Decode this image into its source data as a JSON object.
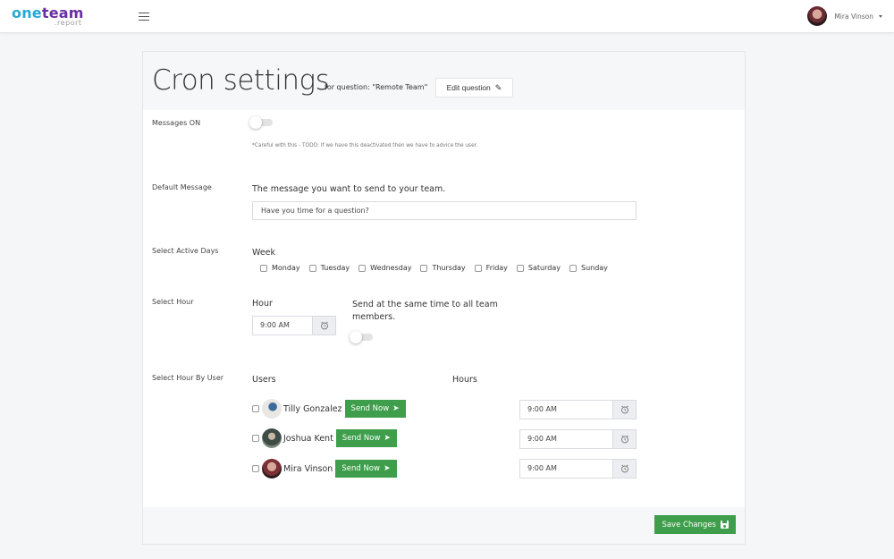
{
  "app": {
    "logo_primary_a": "one",
    "logo_primary_b": "team",
    "logo_secondary": ".report",
    "colors": {
      "logo_blue": "#27a9d6",
      "logo_purple": "#6b2fa3",
      "accent_green": "#3e9e4b"
    }
  },
  "header": {
    "menu_icon": "hamburger-icon",
    "user_name": "Mira Vinson",
    "user_menu_icon": "caret-down-icon"
  },
  "page": {
    "title": "Cron settings",
    "subtitle": "for question: \"Remote Team\"",
    "edit_button": "Edit question",
    "edit_icon": "pencil-icon"
  },
  "messages_on": {
    "label": "Messages ON",
    "enabled": false,
    "hint": "*Careful with this - TODO: If we have this deactivated then we have to advice the user."
  },
  "default_message": {
    "label": "Default Message",
    "description": "The message you want to send to your team.",
    "value": "Have you time for a question?"
  },
  "active_days": {
    "label": "Select Active Days",
    "group_label": "Week",
    "days": [
      {
        "name": "Monday",
        "checked": false
      },
      {
        "name": "Tuesday",
        "checked": false
      },
      {
        "name": "Wednesday",
        "checked": false
      },
      {
        "name": "Thursday",
        "checked": false
      },
      {
        "name": "Friday",
        "checked": false
      },
      {
        "name": "Saturday",
        "checked": false
      },
      {
        "name": "Sunday",
        "checked": false
      }
    ]
  },
  "select_hour": {
    "label": "Select Hour",
    "hour_label": "Hour",
    "hour_value": "9:00 AM",
    "clock_icon": "alarm-clock-icon",
    "same_time_label": "Send at the same time to all team members.",
    "same_time_enabled": false
  },
  "hour_by_user": {
    "label": "Select Hour By User",
    "users_header": "Users",
    "hours_header": "Hours",
    "send_label": "Send Now",
    "send_icon": "paper-plane-icon",
    "users": [
      {
        "name": "Tilly Gonzalez",
        "checked": false,
        "hour": "9:00 AM"
      },
      {
        "name": "Joshua Kent",
        "checked": false,
        "hour": "9:00 AM"
      },
      {
        "name": "Mira Vinson",
        "checked": false,
        "hour": "9:00 AM"
      }
    ]
  },
  "footer": {
    "save_label": "Save Changes",
    "save_icon": "floppy-disk-icon"
  }
}
